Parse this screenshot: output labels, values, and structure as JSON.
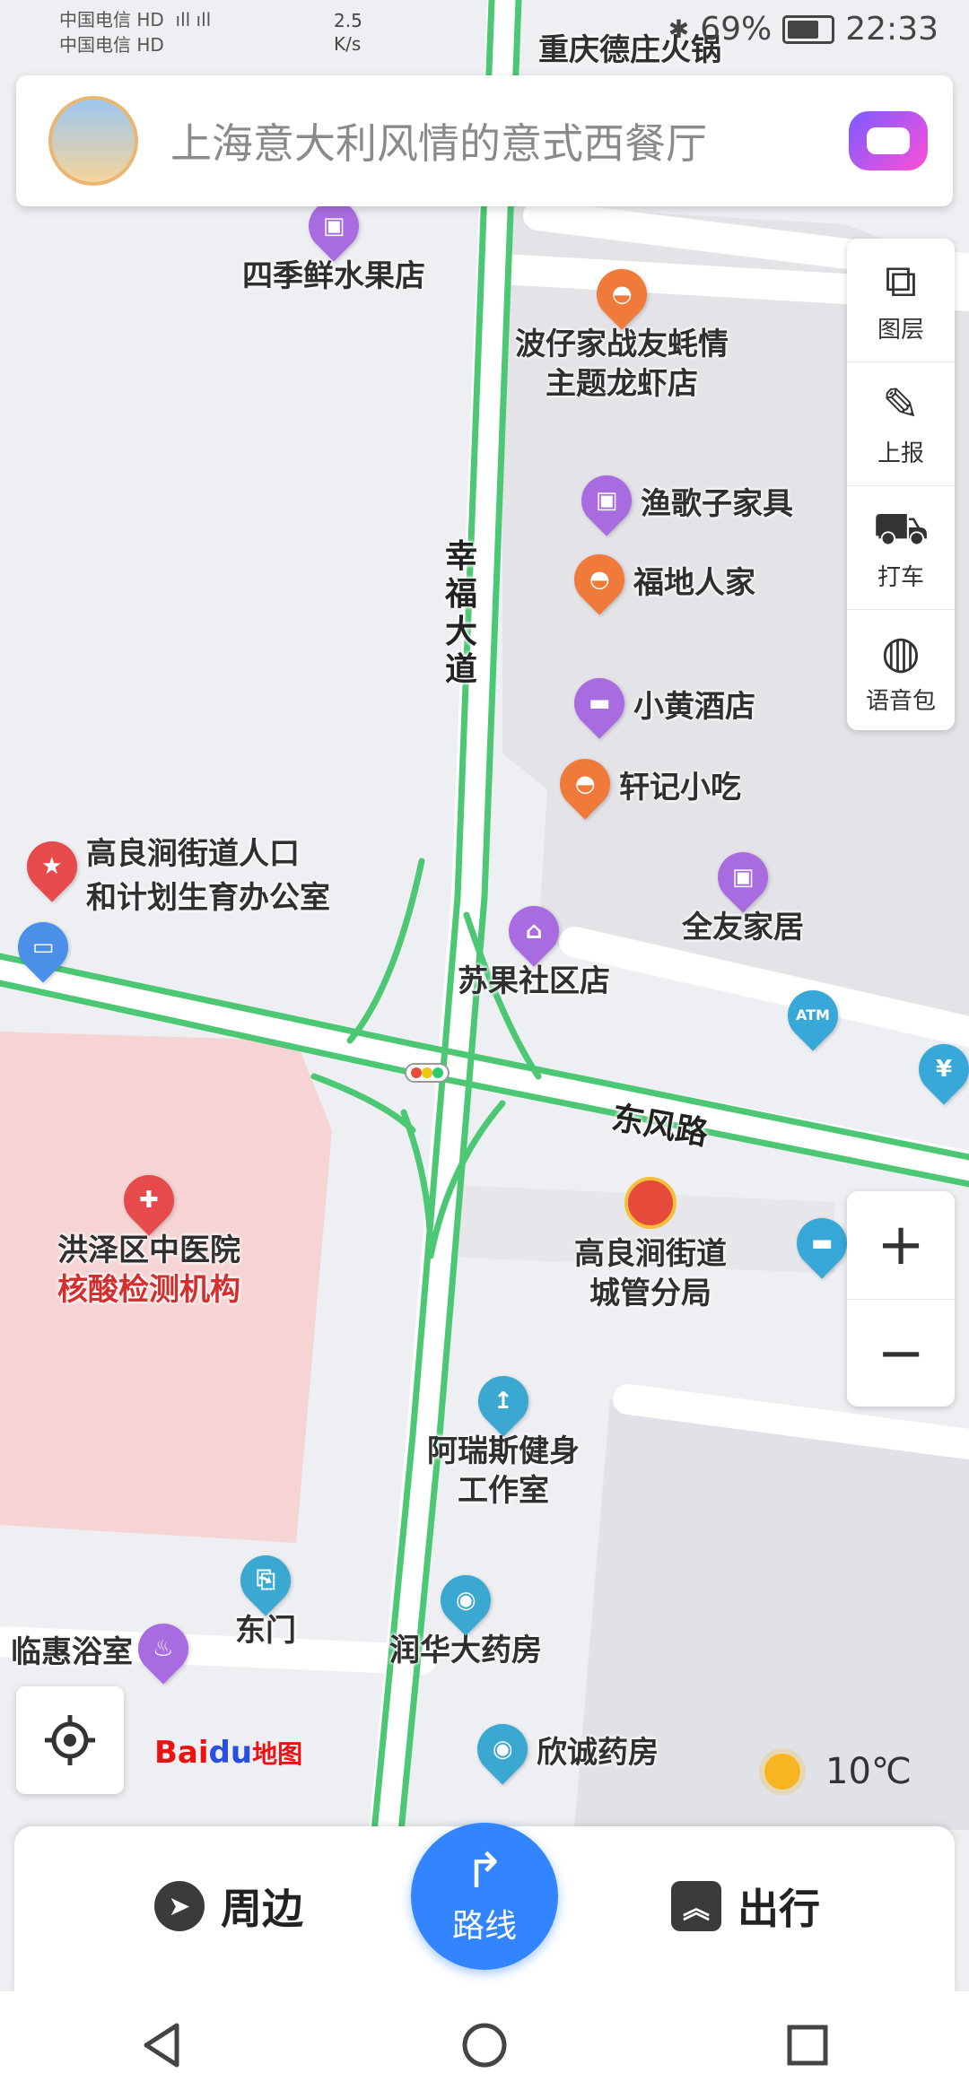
{
  "status_bar": {
    "carrier1": "中国电信",
    "carrier2": "中国电信",
    "net_speed": "2.5 K/s",
    "battery_pct": "69%",
    "time": "22:33"
  },
  "search": {
    "placeholder": "上海意大利风情的意式西餐厅"
  },
  "tools": {
    "layers": "图层",
    "report": "上报",
    "taxi": "打车",
    "voice": "语音包"
  },
  "roads": {
    "xingfu": "幸福大道",
    "dongfeng": "东风路"
  },
  "pois": {
    "chongqing": "重庆德庄火锅",
    "siji": "四季鲜水果店",
    "bozai1": "波仔家战友蚝情",
    "bozai2": "主题龙虾店",
    "yuge": "渔歌子家具",
    "fudi": "福地人家",
    "xiaohuang": "小黄酒店",
    "xuanji": "轩记小吃",
    "gaoliang1": "高良涧街道人口",
    "gaoliang2": "和计划生育办公室",
    "quanyou": "全友家居",
    "suguo": "苏果社区店",
    "hospital": "洪泽区中医院",
    "hospital_sub": "核酸检测机构",
    "chengguan1": "高良涧街道",
    "chengguan2": "城管分局",
    "gym1": "阿瑞斯健身",
    "gym2": "工作室",
    "dongmen": "东门",
    "linhui": "临惠浴室",
    "runhua": "润华大药房",
    "xincheng": "欣诚药房"
  },
  "brand": {
    "logo_bai": "Bai",
    "logo_du": "du",
    "logo_map": "地图"
  },
  "weather": {
    "temp": "10℃"
  },
  "bottom": {
    "nearby": "周边",
    "route": "路线",
    "travel": "出行"
  },
  "colors": {
    "road_green": "#4cc774",
    "hospital_area": "#f6d4d4",
    "accent_blue": "#3385ff"
  }
}
